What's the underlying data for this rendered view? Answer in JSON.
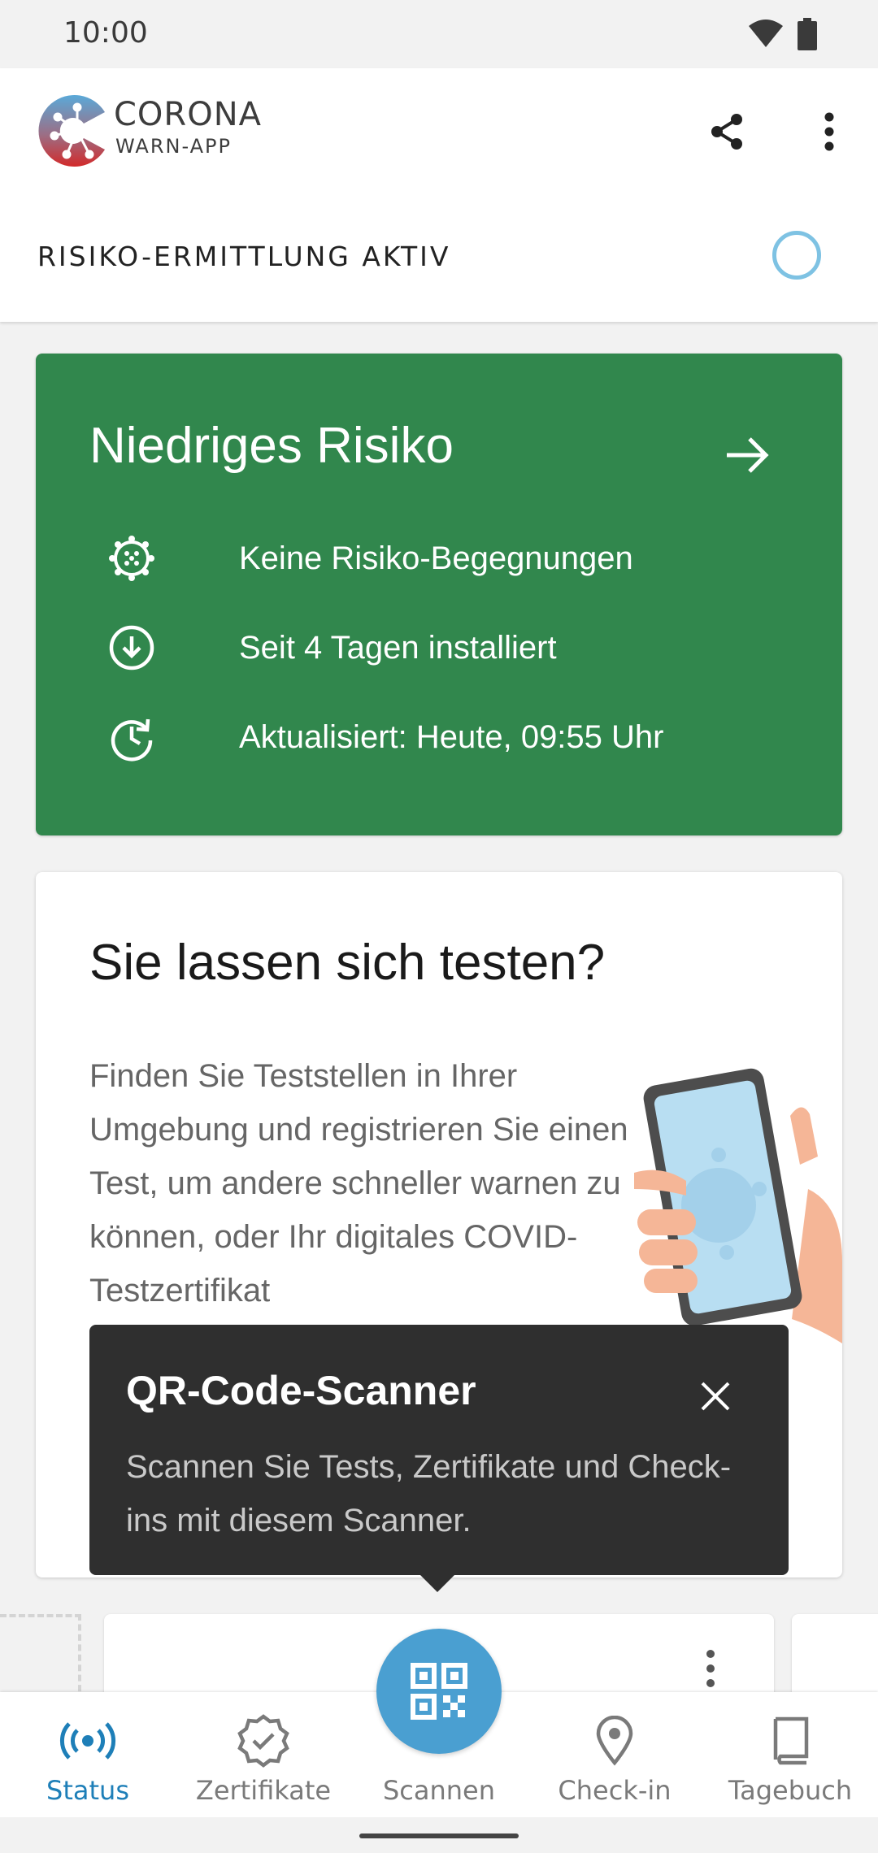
{
  "status_bar": {
    "time": "10:00"
  },
  "header": {
    "logo_title": "CORONA",
    "logo_subtitle": "WARN-APP",
    "risk_detection_label": "RISIKO-ERMITTLUNG AKTIV"
  },
  "risk_card": {
    "title": "Niedriges Risiko",
    "color": "#31874d",
    "rows": [
      {
        "icon": "virus-icon",
        "text": "Keine Risiko-Begegnungen"
      },
      {
        "icon": "download-circle-icon",
        "text": "Seit 4 Tagen installiert"
      },
      {
        "icon": "clock-refresh-icon",
        "text": "Aktualisiert: Heute, 09:55 Uhr"
      }
    ]
  },
  "test_card": {
    "title": "Sie lassen sich testen?",
    "body": "Finden Sie Teststellen in Ihrer Umgebung und registrieren Sie einen Test, um andere schneller warnen zu können, oder Ihr digitales COVID-Testzertifikat"
  },
  "tooltip": {
    "title": "QR-Code-Scanner",
    "text": "Scannen Sie Tests, Zertifikate und Check-ins mit diesem Scanner."
  },
  "bottom_nav": {
    "items": [
      {
        "label": "Status",
        "icon": "broadcast-icon",
        "active": true
      },
      {
        "label": "Zertifikate",
        "icon": "certificate-icon",
        "active": false
      },
      {
        "label": "Scannen",
        "icon": "qr-code-icon",
        "active": false
      },
      {
        "label": "Check-in",
        "icon": "location-pin-icon",
        "active": false
      },
      {
        "label": "Tagebuch",
        "icon": "book-icon",
        "active": false
      }
    ]
  },
  "colors": {
    "accent": "#4a9fd1",
    "active_nav": "#1e7fb8",
    "risk_green": "#31874d",
    "tooltip_bg": "#2f2f2f"
  }
}
